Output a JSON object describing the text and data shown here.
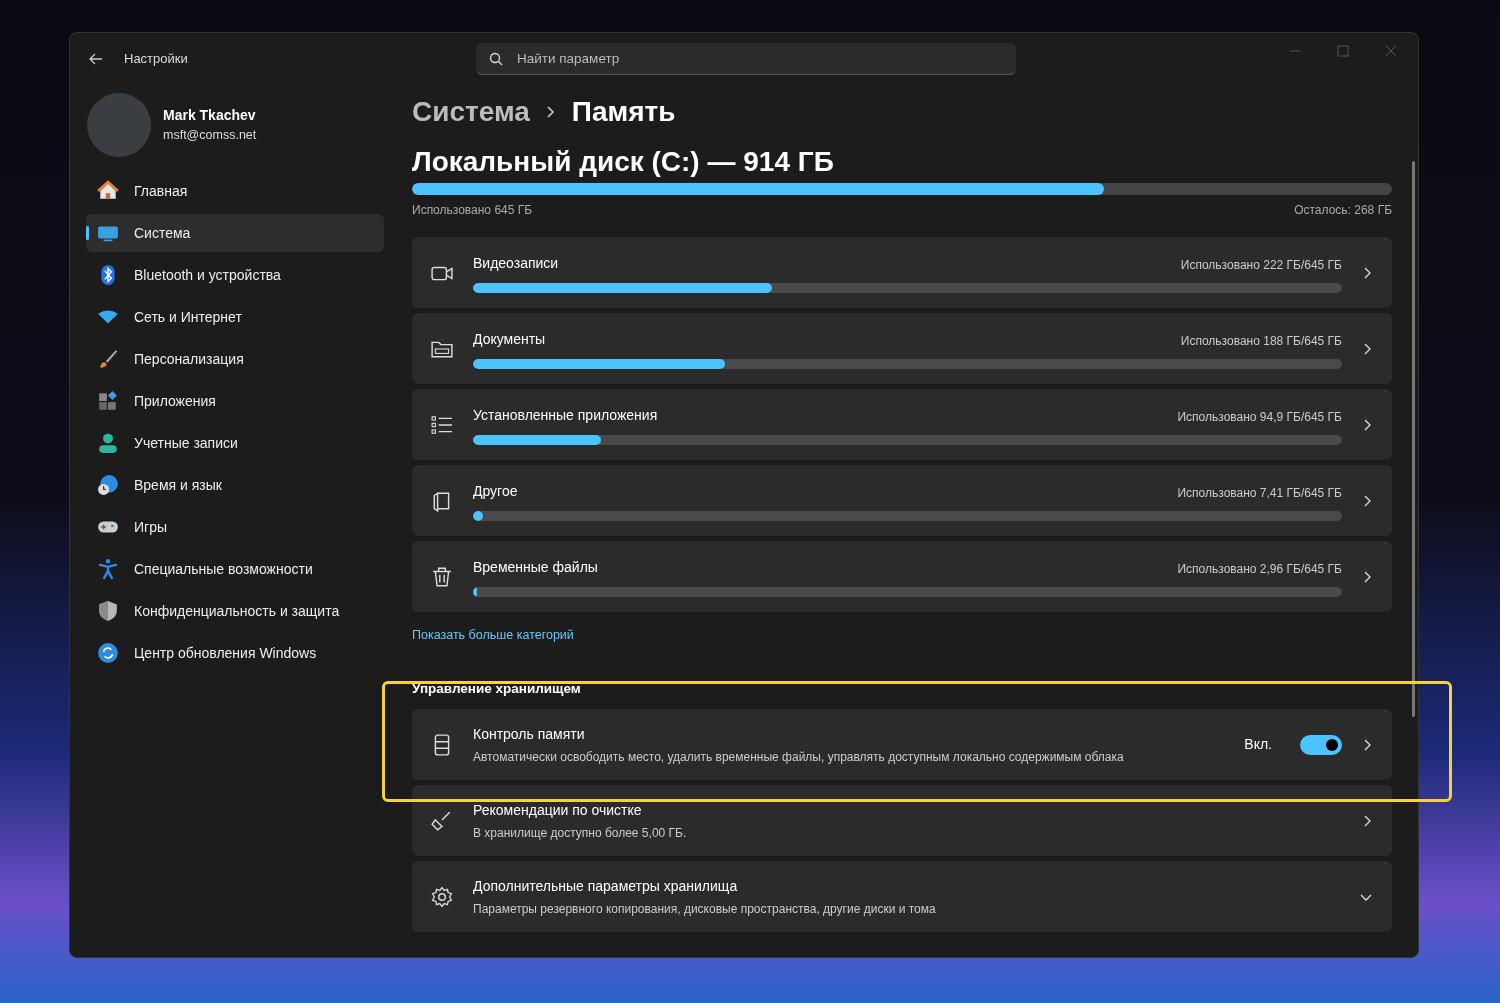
{
  "window": {
    "title": "Настройки",
    "search": {
      "placeholder": "Найти параметр"
    }
  },
  "user": {
    "name": "Mark Tkachev",
    "email": "msft@comss.net"
  },
  "sidebar": {
    "items": [
      {
        "label": "Главная",
        "selected": false
      },
      {
        "label": "Система",
        "selected": true
      },
      {
        "label": "Bluetooth и устройства",
        "selected": false
      },
      {
        "label": "Сеть и Интернет",
        "selected": false
      },
      {
        "label": "Персонализация",
        "selected": false
      },
      {
        "label": "Приложения",
        "selected": false
      },
      {
        "label": "Учетные записи",
        "selected": false
      },
      {
        "label": "Время и язык",
        "selected": false
      },
      {
        "label": "Игры",
        "selected": false
      },
      {
        "label": "Специальные возможности",
        "selected": false
      },
      {
        "label": "Конфиденциальность и защита",
        "selected": false
      },
      {
        "label": "Центр обновления Windows",
        "selected": false
      }
    ]
  },
  "breadcrumb": [
    "Система",
    "Память"
  ],
  "disk": {
    "title": "Локальный диск (C:) — 914 ГБ",
    "level": 0.706,
    "used": "Использовано 645 ГБ",
    "free": "Осталось: 268 ГБ"
  },
  "categories": [
    {
      "label": "Видеозаписи",
      "usage": "Использовано 222 ГБ/645 ГБ",
      "level": 0.344
    },
    {
      "label": "Документы",
      "usage": "Использовано 188 ГБ/645 ГБ",
      "level": 0.29
    },
    {
      "label": "Установленные приложения",
      "usage": "Использовано 94,9 ГБ/645 ГБ",
      "level": 0.147
    },
    {
      "label": "Другое",
      "usage": "Использовано 7,41 ГБ/645 ГБ",
      "level": 0.011
    },
    {
      "label": "Временные файлы",
      "usage": "Использовано 2,96 ГБ/645 ГБ",
      "level": 0.005
    }
  ],
  "more_link": "Показать больше категорий",
  "management": {
    "heading": "Управление хранилищем",
    "highlighted": true,
    "items": [
      {
        "title": "Контроль памяти",
        "description": "Автоматически освободить место, удалить временные файлы, управлять доступным локально содержимым облака",
        "toggle": {
          "label": "Вкл.",
          "on": true
        },
        "kind": "link"
      },
      {
        "title": "Рекомендации по очистке",
        "description": "В хранилище доступно более 5,00 ГБ.",
        "kind": "link"
      },
      {
        "title": "Дополнительные параметры хранилища",
        "description": "Параметры резервного копирования, дисковые пространства, другие диски и тома",
        "kind": "expand"
      }
    ]
  }
}
